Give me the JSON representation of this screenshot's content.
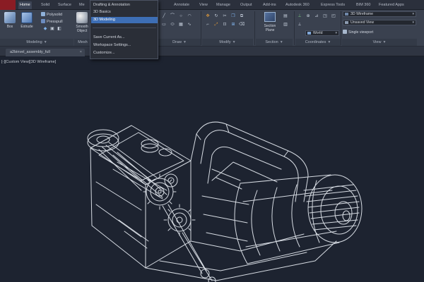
{
  "ribbon_tabs": [
    {
      "label": "Home",
      "active": true
    },
    {
      "label": "Solid",
      "active": false
    },
    {
      "label": "Surface",
      "active": false
    },
    {
      "label": "Me",
      "active": false
    },
    {
      "label": "Annotate",
      "active": false
    },
    {
      "label": "View",
      "active": false
    },
    {
      "label": "Manage",
      "active": false
    },
    {
      "label": "Output",
      "active": false
    },
    {
      "label": "Add-ins",
      "active": false
    },
    {
      "label": "Autodesk 360",
      "active": false
    },
    {
      "label": "Express Tools",
      "active": false
    },
    {
      "label": "BIM 360",
      "active": false
    },
    {
      "label": "Featured Apps",
      "active": false
    }
  ],
  "modeling": {
    "box_label": "Box",
    "extrude_label": "Extrude",
    "polysolid_label": "Polysolid",
    "presspull_label": "Presspull",
    "smooth_label_1": "Smooth",
    "smooth_label_2": "Object",
    "panel_title": "Modeling",
    "mesh_title": "Mesh"
  },
  "panels": {
    "draw": "Draw",
    "modify": "Modify",
    "section": "Section",
    "coordinates": "Coordinates",
    "view": "View"
  },
  "section_plane": {
    "line1": "Section",
    "line2": "Plane"
  },
  "coordinates": {
    "ucs_value": "World"
  },
  "view_panel": {
    "visual_style": "3D Wireframe",
    "view_name": "Unsaved View",
    "viewport_config": "Single viewport"
  },
  "workspace_menu": {
    "items": [
      {
        "label": "Drafting & Annotation",
        "selected": false
      },
      {
        "label": "3D Basics",
        "selected": false
      },
      {
        "label": "3D Modeling",
        "selected": true
      }
    ],
    "actions": [
      {
        "label": "Save Current As..."
      },
      {
        "label": "Workspace Settings..."
      },
      {
        "label": "Customize..."
      }
    ]
  },
  "file_tab": {
    "name": "a2binvel_assembly_full",
    "close": "×"
  },
  "viewport": {
    "label": "[-][Custom View][3D Wireframe]"
  },
  "colors": {
    "ribbon_bg": "#3a414f",
    "viewport_bg": "#1d2330",
    "selection_blue": "#3d6eb5",
    "app_red": "#8a1c24",
    "wireframe": "#e6ebf2"
  },
  "icons": {
    "app": "autocad-app-icon",
    "box": "box-solid-icon",
    "extrude": "extrude-icon",
    "smooth": "smooth-object-icon",
    "section": "section-plane-icon"
  }
}
